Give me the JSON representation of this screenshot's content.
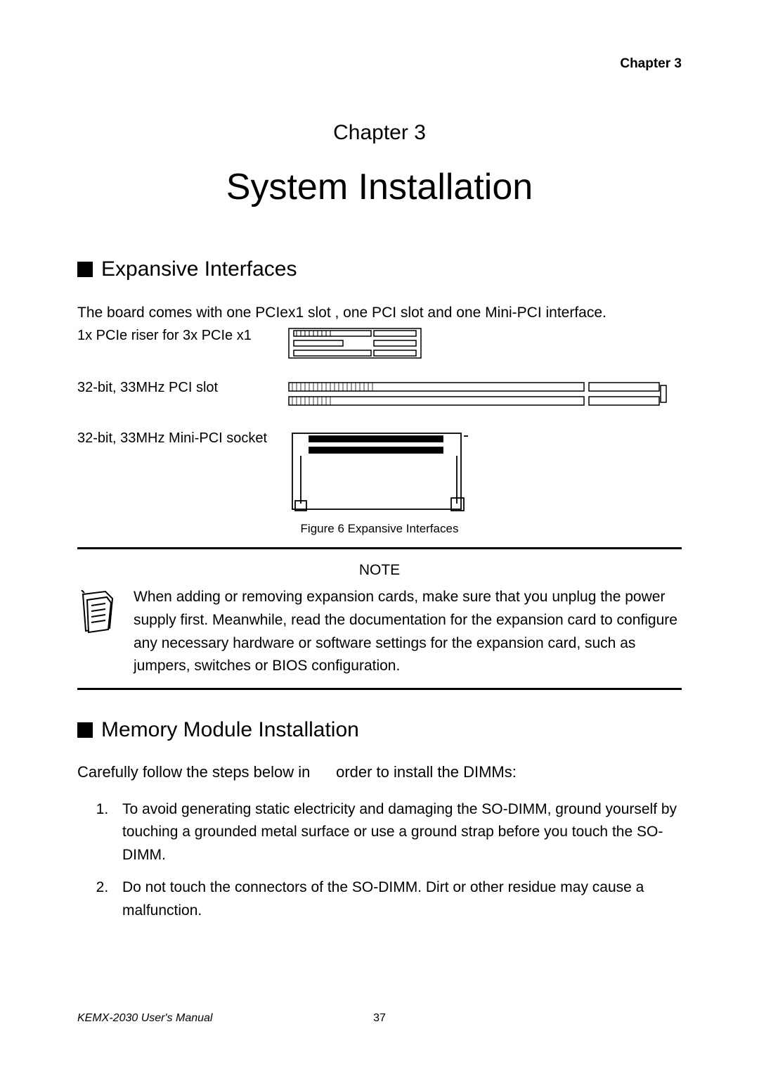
{
  "header": {
    "chapter_label": "Chapter 3"
  },
  "chapter_line": "Chapter 3",
  "title": "System Installation",
  "sections": {
    "expansive": {
      "heading": "Expansive Interfaces",
      "intro": "The board comes with one PCIex1 slot , one PCI slot and one Mini-PCI interface.",
      "rows": [
        {
          "label": "1x PCIe riser for 3x PCIe x1"
        },
        {
          "label": "32-bit, 33MHz PCI slot"
        },
        {
          "label": "32-bit, 33MHz Mini-PCI socket"
        }
      ],
      "figure_caption": "Figure 6 Expansive Interfaces"
    },
    "note": {
      "title": "NOTE",
      "text": "When adding or removing expansion cards, make sure that you unplug the power supply first. Meanwhile, read the documentation for the expansion card to configure any necessary hardware or software settings for the expansion card, such as jumpers, switches or BIOS configuration."
    },
    "memory": {
      "heading": "Memory Module Installation",
      "subhead_a": "Carefully follow the steps below in",
      "subhead_b": "order to install the DIMMs:",
      "steps": [
        "To avoid generating static electricity and damaging the SO-DIMM, ground yourself by touching a grounded metal surface or use a ground strap before you touch the SO-DIMM.",
        "Do not touch the connectors of the SO-DIMM. Dirt or other residue may cause a malfunction."
      ]
    }
  },
  "footer": {
    "manual": "KEMX-2030 User's Manual",
    "page": "37"
  }
}
